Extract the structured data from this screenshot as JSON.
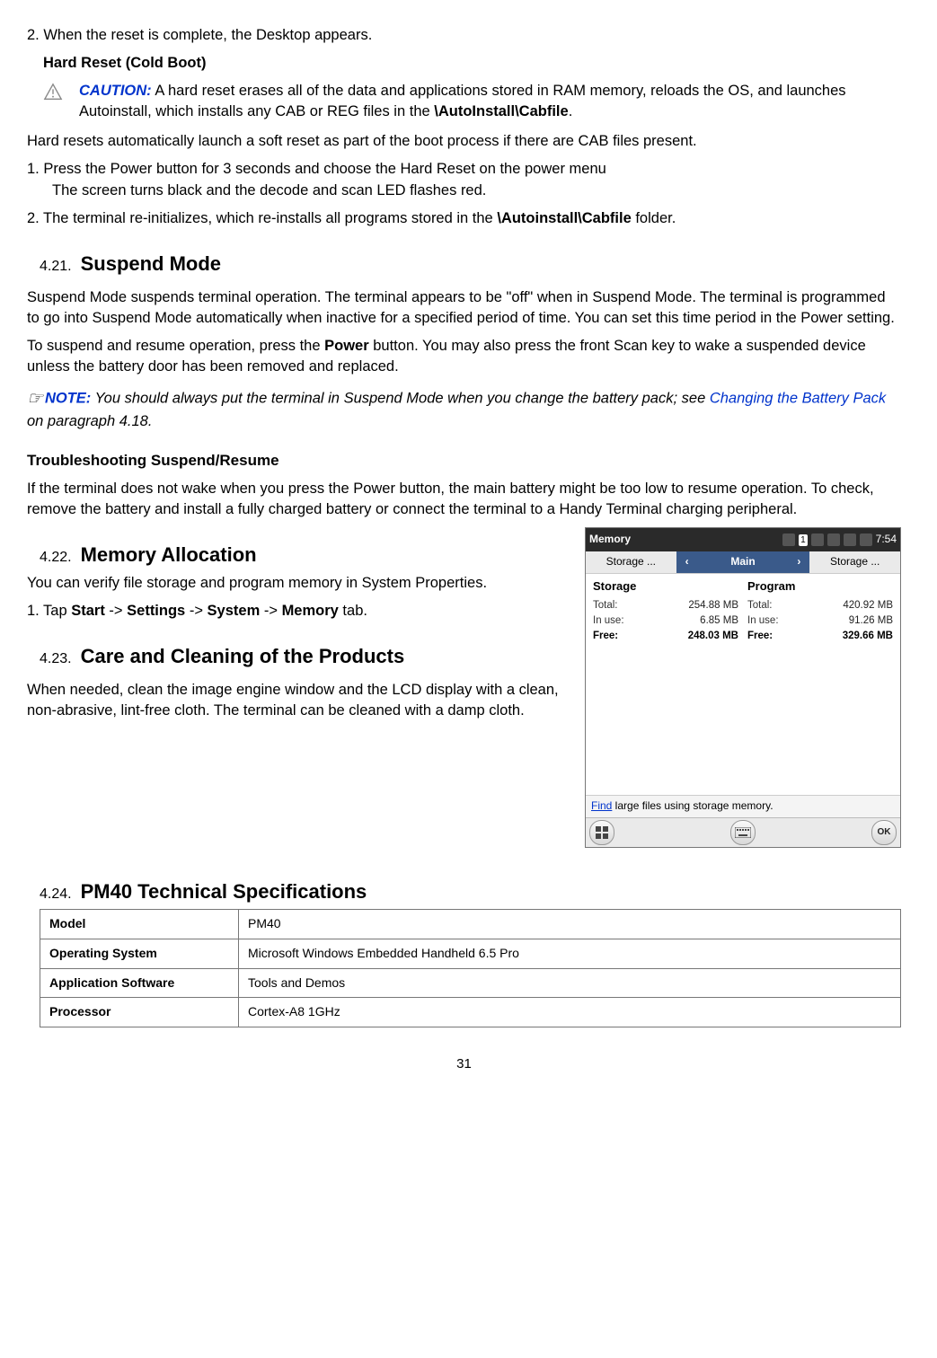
{
  "step2_reset_complete": "2. When the reset is complete, the Desktop appears.",
  "hard_reset_heading": "Hard Reset (Cold Boot)",
  "caution_label": "CAUTION:",
  "caution_text": " A hard reset erases all of the data and applications stored in RAM memory, reloads the OS, and launches Autoinstall, which installs any CAB or REG files in the ",
  "caution_path": "\\AutoInstall\\Cabfile",
  "caution_period": ".",
  "hard_reset_p1": "Hard resets automatically launch a soft reset as part of the boot process if there are CAB files present.",
  "hard_reset_step1_a": "1. Press the Power button for 3 seconds and choose the Hard Reset on the power menu ",
  "hard_reset_step1_b": "The screen turns black and the decode and scan LED flashes red.",
  "hard_reset_step2_a": "2. The terminal re-initializes, which re-installs all programs stored in the ",
  "hard_reset_step2_b": "\\Autoinstall\\Cabfile",
  "hard_reset_step2_c": " folder.",
  "sec_421_num": "4.21.",
  "sec_421_title": "Suspend Mode",
  "sec_421_p1": "Suspend Mode suspends terminal operation. The terminal appears to be \"off\" when in Suspend Mode. The terminal is programmed to go into Suspend Mode automatically when inactive for a specified period of time. You can set this time period in the Power setting.",
  "sec_421_p2_a": "To suspend and resume operation, press the ",
  "sec_421_p2_b": "Power",
  "sec_421_p2_c": " button. You may also press the front Scan key to wake a suspended device unless the battery door has been removed and replaced.",
  "note_label": "NOTE:",
  "note_text_a": " You should always put the terminal in Suspend Mode when you change the battery pack; see ",
  "note_link": "Changing the Battery Pack",
  "note_text_b": " on paragraph 4.18.",
  "troubleshoot_heading": "Troubleshooting Suspend/Resume",
  "troubleshoot_p": "If the terminal does not wake when you press the Power button, the main battery might be too low to resume operation. To check, remove the battery and install a fully charged battery or connect the terminal to a Handy Terminal charging peripheral.",
  "sec_422_num": "4.22.",
  "sec_422_title": "Memory Allocation",
  "sec_422_p1": "You can verify file storage and program memory in System Properties.",
  "sec_422_step_a": "1. Tap ",
  "sec_422_start": "Start",
  "sec_422_arrow": " -> ",
  "sec_422_settings": "Settings",
  "sec_422_system": "System",
  "sec_422_memory": "Memory",
  "sec_422_step_b": " tab.",
  "sec_423_num": "4.23.",
  "sec_423_title": "Care and Cleaning of the Products",
  "sec_423_p": "When needed, clean the image engine window and the LCD display with a clean, non-abrasive, lint-free cloth. The terminal can be cleaned with a damp cloth.",
  "sec_424_num": "4.24.",
  "sec_424_title": "PM40 Technical Specifications",
  "specs": {
    "model_k": "Model",
    "model_v": "PM40",
    "os_k": "Operating System",
    "os_v": "Microsoft Windows Embedded Handheld 6.5 Pro",
    "app_k": "Application Software",
    "app_v": "Tools and Demos",
    "proc_k": "Processor",
    "proc_v": "Cortex-A8 1GHz"
  },
  "page_number": "31",
  "wm": {
    "title": "Memory",
    "time": "7:54",
    "tab_left": "Storage ...",
    "tab_main": "Main",
    "tab_right": "Storage ...",
    "storage_title": "Storage",
    "program_title": "Program",
    "lbl_total": "Total:",
    "lbl_inuse": "In use:",
    "lbl_free": "Free:",
    "storage_total": "254.88 MB",
    "storage_inuse": "6.85 MB",
    "storage_free": "248.03 MB",
    "program_total": "420.92 MB",
    "program_inuse": "91.26 MB",
    "program_free": "329.66 MB",
    "link_find": "Find",
    "link_rest": " large files using storage memory.",
    "ok": "OK"
  }
}
